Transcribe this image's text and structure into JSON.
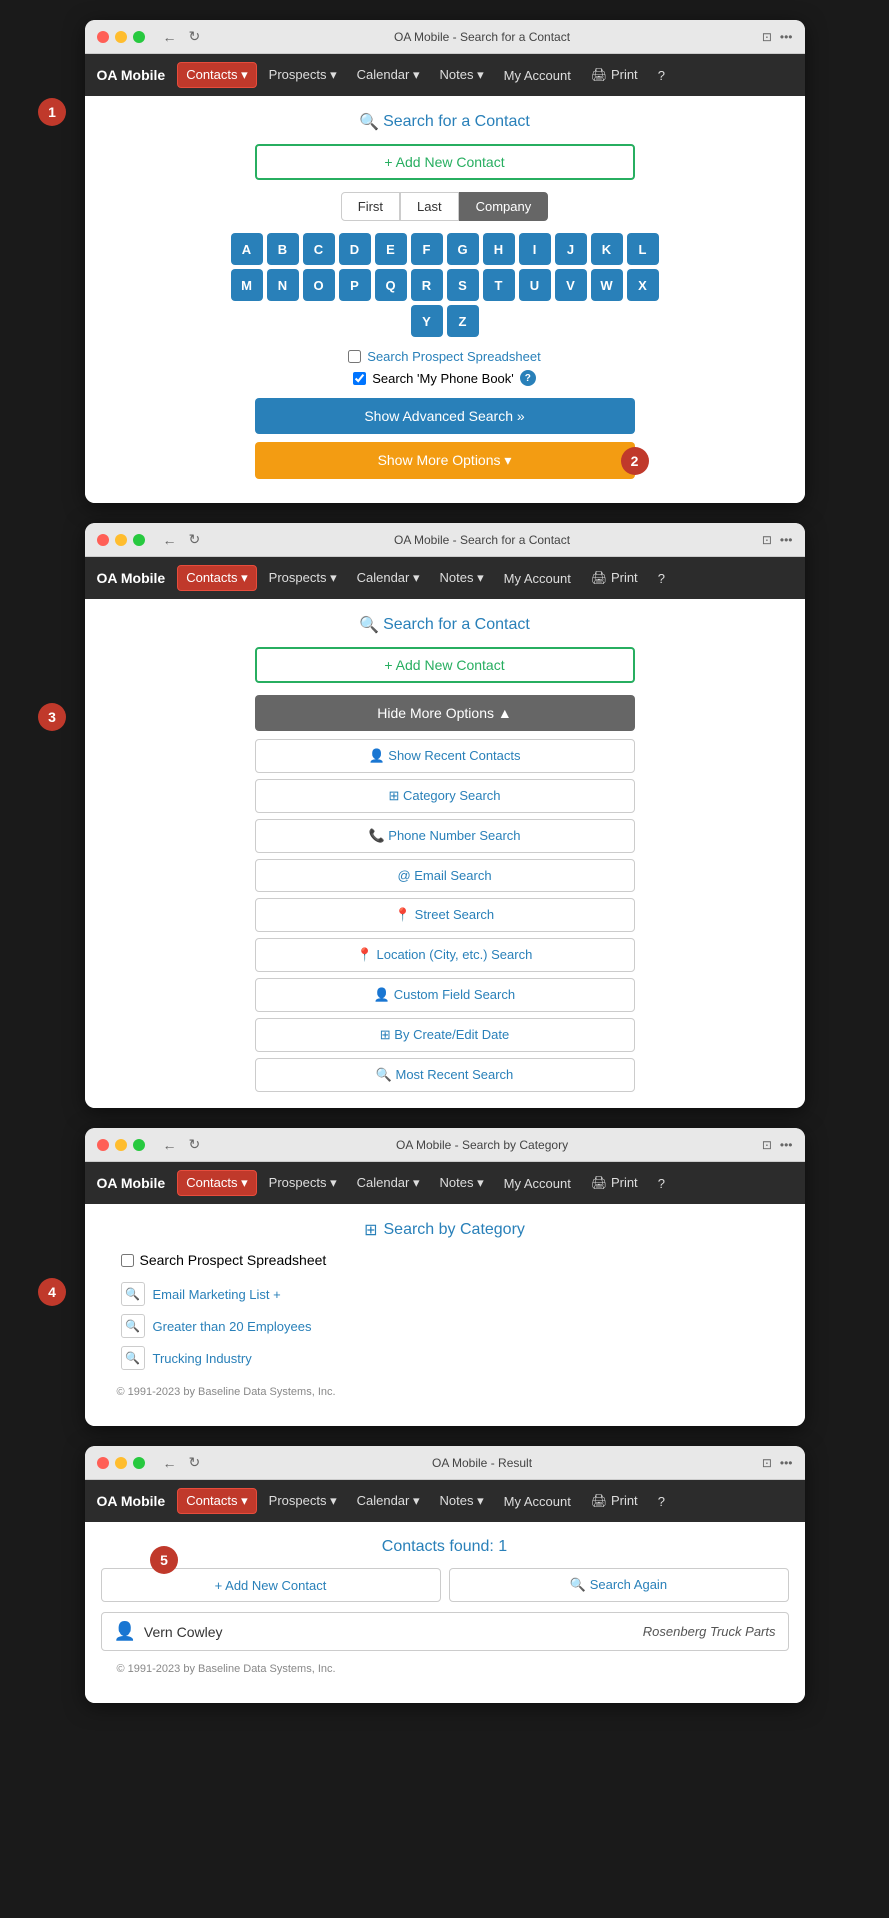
{
  "app": {
    "brand": "OA Mobile",
    "nav_items": [
      "Contacts",
      "Prospects",
      "Calendar",
      "Notes",
      "My Account",
      "Print",
      "?"
    ]
  },
  "window1": {
    "title": "OA Mobile - Search for a Contact",
    "page_title": "Search for a Contact",
    "add_contact_btn": "+ Add New Contact",
    "tabs": [
      "First",
      "Last",
      "Company"
    ],
    "alphabet": [
      "A",
      "B",
      "C",
      "D",
      "E",
      "F",
      "G",
      "H",
      "I",
      "J",
      "K",
      "L",
      "M",
      "N",
      "O",
      "P",
      "Q",
      "R",
      "S",
      "T",
      "U",
      "V",
      "W",
      "X",
      "Y",
      "Z"
    ],
    "checkbox1_label": "Search Prospect Spreadsheet",
    "checkbox2_label": "Search 'My Phone Book'",
    "show_advanced_btn": "Show Advanced Search »",
    "show_more_btn": "Show More Options ▾",
    "badge": "1",
    "badge2": "2"
  },
  "window2": {
    "title": "OA Mobile - Search for a Contact",
    "page_title": "Search for a Contact",
    "add_contact_btn": "+ Add New Contact",
    "hide_more_btn": "Hide More Options ▲",
    "options": [
      {
        "icon": "👤",
        "label": "Show Recent Contacts"
      },
      {
        "icon": "⊞",
        "label": "Category Search"
      },
      {
        "icon": "📞",
        "label": "Phone Number Search"
      },
      {
        "icon": "@",
        "label": "Email Search"
      },
      {
        "icon": "📍",
        "label": "Street Search"
      },
      {
        "icon": "📍",
        "label": "Location (City, etc.) Search"
      },
      {
        "icon": "👤",
        "label": "Custom Field Search"
      },
      {
        "icon": "⊞",
        "label": "By Create/Edit Date"
      },
      {
        "icon": "🔍",
        "label": "Most Recent Search"
      }
    ],
    "badge": "3"
  },
  "window3": {
    "title": "OA Mobile - Search by Category",
    "page_title": "Search by Category",
    "checkbox_label": "Search Prospect Spreadsheet",
    "categories": [
      "Email Marketing List +",
      "Greater than 20 Employees",
      "Trucking Industry"
    ],
    "footer": "© 1991-2023 by Baseline Data Systems, Inc.",
    "badge": "4"
  },
  "window4": {
    "title": "OA Mobile - Result",
    "page_title": "Contacts found: 1",
    "add_contact_btn": "+ Add New Contact",
    "search_again_btn": "🔍 Search Again",
    "contact_name": "Vern Cowley",
    "contact_company": "Rosenberg Truck Parts",
    "footer": "© 1991-2023 by Baseline Data Systems, Inc.",
    "badge": "5"
  }
}
